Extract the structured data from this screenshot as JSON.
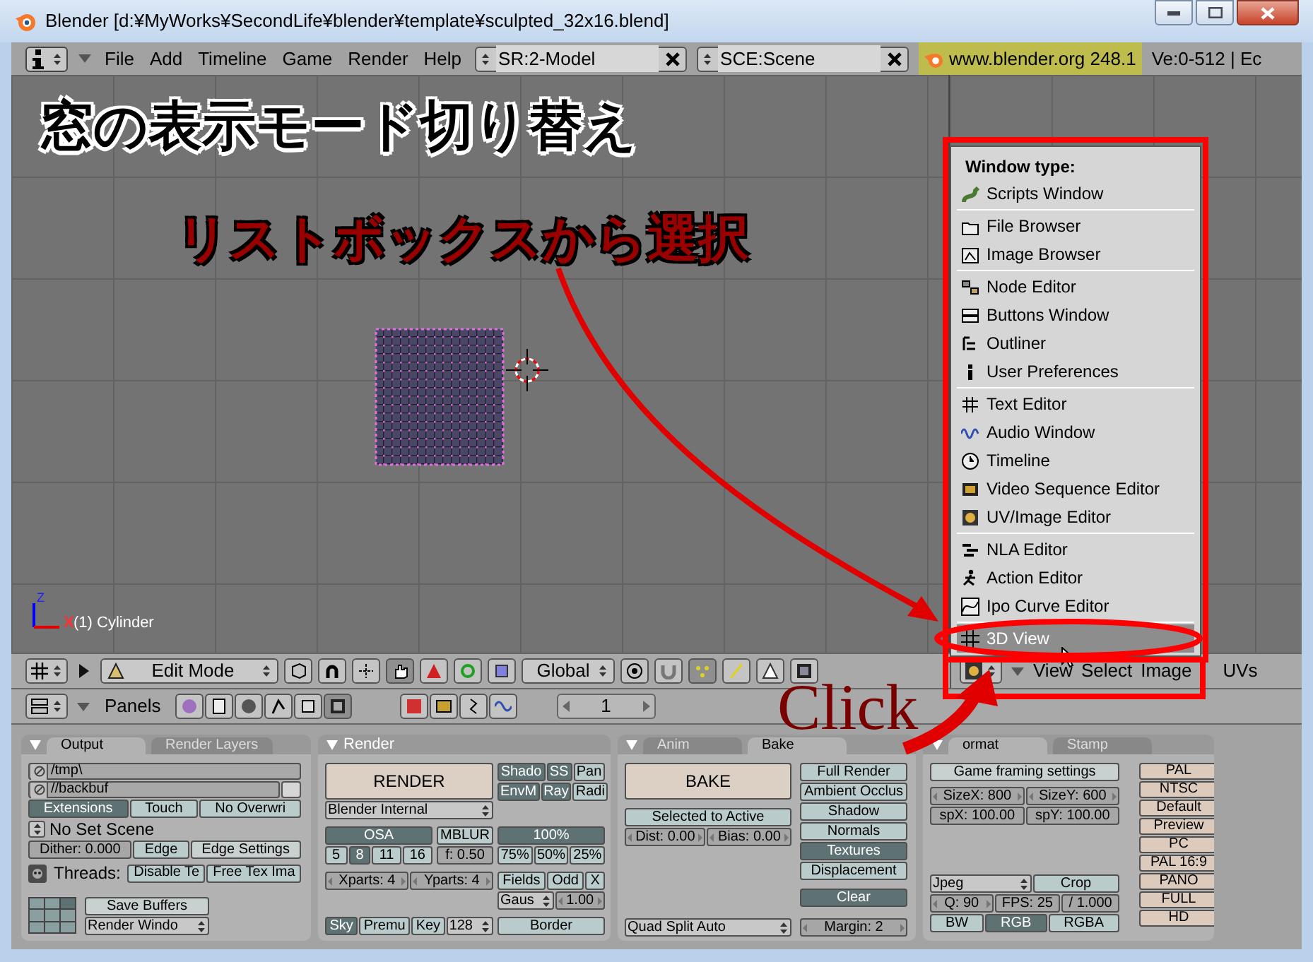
{
  "window": {
    "title": "Blender [d:¥MyWorks¥SecondLife¥blender¥template¥sculpted_32x16.blend]"
  },
  "menubar": {
    "menus": [
      "File",
      "Add",
      "Timeline",
      "Game",
      "Render",
      "Help"
    ],
    "screen": "SR:2-Model",
    "scene": "SCE:Scene",
    "version": "www.blender.org 248.1",
    "stats": "Ve:0-512 | Ec"
  },
  "viewport": {
    "object_label": "(1) Cylinder",
    "axes": [
      "Z",
      "X"
    ]
  },
  "annotations": {
    "heading": "窓の表示モード切り替え",
    "subheading": "リストボックスから選択",
    "callout": "Click"
  },
  "window_type_menu": {
    "title": "Window type:",
    "groups": [
      [
        {
          "label": "Scripts Window",
          "highlighted": false
        }
      ],
      [
        {
          "label": "File Browser",
          "highlighted": false
        },
        {
          "label": "Image Browser",
          "highlighted": false
        }
      ],
      [
        {
          "label": "Node Editor",
          "highlighted": false
        },
        {
          "label": "Buttons Window",
          "highlighted": false
        },
        {
          "label": "Outliner",
          "highlighted": false
        },
        {
          "label": "User Preferences",
          "highlighted": false
        }
      ],
      [
        {
          "label": "Text Editor",
          "highlighted": false
        },
        {
          "label": "Audio Window",
          "highlighted": false
        },
        {
          "label": "Timeline",
          "highlighted": false
        },
        {
          "label": "Video Sequence Editor",
          "highlighted": false
        },
        {
          "label": "UV/Image Editor",
          "highlighted": false
        }
      ],
      [
        {
          "label": "NLA Editor",
          "highlighted": false
        },
        {
          "label": "Action Editor",
          "highlighted": false
        },
        {
          "label": "Ipo Curve Editor",
          "highlighted": false
        }
      ],
      [
        {
          "label": "3D View",
          "highlighted": true
        }
      ]
    ]
  },
  "view_header": {
    "mode": "Edit Mode",
    "orientation": "Global"
  },
  "image_header": {
    "menus": [
      "View",
      "Select",
      "Image",
      "UVs"
    ]
  },
  "buttons_header": {
    "label": "Panels",
    "frame": "1"
  },
  "panels": [
    {
      "tabs": [
        {
          "label": "Output",
          "selected": true
        },
        {
          "label": "Render Layers",
          "selected": false
        }
      ],
      "sections": [
        {
          "kind": "buttons",
          "lines": [
            [
              {
                "kind": "path",
                "label": "/tmp\\"
              }
            ],
            [
              {
                "kind": "path",
                "label": "//backbuf"
              },
              {
                "kind": "square"
              }
            ],
            [
              {
                "kind": "toggle",
                "label": "Extensions",
                "on": true
              },
              {
                "kind": "toggle",
                "label": "Touch",
                "on": false
              },
              {
                "kind": "toggle",
                "label": "No Overwri",
                "on": false
              }
            ],
            [
              {
                "kind": "picker",
                "label": "No Set Scene"
              }
            ],
            [
              {
                "kind": "value",
                "label": "Dither: 0.000"
              },
              {
                "kind": "toggle",
                "label": "Edge",
                "on": false
              },
              {
                "kind": "push",
                "label": "Edge Settings"
              }
            ],
            [
              {
                "kind": "iconbutton"
              },
              {
                "kind": "label",
                "label": "Threads:"
              },
              {
                "kind": "toggle",
                "label": "Disable Te",
                "on": false
              },
              {
                "kind": "toggle",
                "label": "Free Tex Ima",
                "on": false
              }
            ]
          ]
        },
        {
          "kind": "layout"
        },
        {
          "kind": "buttons",
          "lines": [
            [
              {
                "kind": "push",
                "label": "Save Buffers"
              }
            ],
            [
              {
                "kind": "menu",
                "label": "Render Windo"
              }
            ]
          ]
        }
      ]
    },
    {
      "title": "Render",
      "sections": [
        {
          "kind": "buttons",
          "lines": [
            [
              {
                "kind": "bigaction",
                "label": "RENDER"
              }
            ],
            [
              {
                "kind": "menu",
                "label": "Blender Internal"
              }
            ]
          ]
        },
        {
          "kind": "buttons",
          "lines": [
            [
              {
                "kind": "toggle",
                "label": "Shado",
                "on": true
              },
              {
                "kind": "toggle",
                "label": "SS",
                "on": true
              },
              {
                "kind": "toggle",
                "label": "Pan",
                "on": false
              }
            ],
            [
              {
                "kind": "toggle",
                "label": "EnvM",
                "on": true
              },
              {
                "kind": "toggle",
                "label": "Ray",
                "on": true
              },
              {
                "kind": "toggle",
                "label": "Radi",
                "on": false
              }
            ]
          ]
        },
        {
          "kind": "buttons",
          "lines": [
            [
              {
                "kind": "toggle",
                "label": "OSA",
                "on": true
              }
            ],
            [
              {
                "kind": "toggle",
                "label": "5",
                "on": false
              },
              {
                "kind": "toggle",
                "label": "8",
                "on": true
              },
              {
                "kind": "toggle",
                "label": "11",
                "on": false
              },
              {
                "kind": "toggle",
                "label": "16",
                "on": false
              }
            ]
          ]
        },
        {
          "kind": "buttons",
          "lines": [
            [
              {
                "kind": "toggle",
                "label": "MBLUR",
                "on": false
              }
            ],
            [
              {
                "kind": "value",
                "label": "f: 0.50"
              }
            ]
          ]
        },
        {
          "kind": "buttons",
          "lines": [
            [
              {
                "kind": "toggle",
                "label": "100%",
                "on": true
              }
            ],
            [
              {
                "kind": "toggle",
                "label": "75%",
                "on": false
              },
              {
                "kind": "toggle",
                "label": "50%",
                "on": false
              },
              {
                "kind": "toggle",
                "label": "25%",
                "on": false
              }
            ]
          ]
        },
        {
          "kind": "buttons",
          "lines": [
            [
              {
                "kind": "number",
                "label": "Xparts: 4"
              },
              {
                "kind": "number",
                "label": "Yparts: 4"
              }
            ]
          ]
        },
        {
          "kind": "buttons",
          "lines": [
            [
              {
                "kind": "toggle",
                "label": "Fields",
                "on": false
              },
              {
                "kind": "toggle",
                "label": "Odd",
                "on": false
              },
              {
                "kind": "toggle",
                "label": "X",
                "on": false
              }
            ],
            [
              {
                "kind": "menu",
                "label": "Gaus"
              },
              {
                "kind": "number",
                "label": "1.00"
              }
            ]
          ]
        },
        {
          "kind": "buttons",
          "lines": [
            [
              {
                "kind": "toggle",
                "label": "Sky",
                "on": true
              },
              {
                "kind": "toggle",
                "label": "Premu",
                "on": false
              },
              {
                "kind": "toggle",
                "label": "Key",
                "on": false
              },
              {
                "kind": "menu",
                "label": "128"
              }
            ]
          ]
        },
        {
          "kind": "buttons",
          "lines": [
            [
              {
                "kind": "toggle",
                "label": "Border",
                "on": false
              }
            ]
          ]
        }
      ]
    },
    {
      "tabs": [
        {
          "label": "Anim",
          "selected": false
        },
        {
          "label": "Bake",
          "selected": true
        }
      ],
      "sections": [
        {
          "kind": "buttons",
          "lines": [
            [
              {
                "kind": "bigaction",
                "label": "BAKE"
              }
            ]
          ]
        },
        {
          "kind": "buttons",
          "lines": [
            [
              {
                "kind": "toggle",
                "label": "Selected to Active",
                "on": false
              }
            ],
            [
              {
                "kind": "number",
                "label": "Dist: 0.00"
              },
              {
                "kind": "number",
                "label": "Bias: 0.00"
              }
            ]
          ]
        },
        {
          "kind": "buttons",
          "lines": [
            [
              {
                "kind": "toggle",
                "label": "Full Render",
                "on": false
              }
            ],
            [
              {
                "kind": "toggle",
                "label": "Ambient Occlus",
                "on": false
              }
            ],
            [
              {
                "kind": "toggle",
                "label": "Shadow",
                "on": false
              }
            ],
            [
              {
                "kind": "toggle",
                "label": "Normals",
                "on": false
              }
            ],
            [
              {
                "kind": "toggle",
                "label": "Textures",
                "on": true
              }
            ],
            [
              {
                "kind": "toggle",
                "label": "Displacement",
                "on": false
              }
            ]
          ]
        },
        {
          "kind": "buttons",
          "lines": [
            [
              {
                "kind": "menu",
                "label": "Quad Split Auto"
              }
            ]
          ]
        },
        {
          "kind": "buttons",
          "lines": [
            [
              {
                "kind": "command",
                "label": "Clear"
              }
            ],
            [
              {
                "kind": "number",
                "label": "Margin: 2"
              }
            ]
          ]
        }
      ]
    },
    {
      "tabs": [
        {
          "label": "ormat",
          "selected": true
        },
        {
          "label": "Stamp",
          "selected": false
        }
      ],
      "sections": [
        {
          "kind": "buttons",
          "lines": [
            [
              {
                "kind": "push",
                "label": "Game framing settings"
              }
            ]
          ]
        },
        {
          "kind": "buttons",
          "lines": [
            [
              {
                "kind": "number",
                "label": "SizeX: 800"
              },
              {
                "kind": "number",
                "label": "SizeY: 600"
              }
            ],
            [
              {
                "kind": "value",
                "label": "spX: 100.00"
              },
              {
                "kind": "value",
                "label": "spY: 100.00"
              }
            ]
          ]
        },
        {
          "kind": "buttons",
          "lines": [
            [
              {
                "kind": "menu",
                "label": "Jpeg"
              },
              {
                "kind": "toggle",
                "label": "Crop",
                "on": false
              }
            ],
            [
              {
                "kind": "number",
                "label": "Q: 90"
              },
              {
                "kind": "value",
                "label": "FPS: 25"
              },
              {
                "kind": "value",
                "label": "/ 1.000"
              }
            ],
            [
              {
                "kind": "toggle",
                "label": "BW",
                "on": false
              },
              {
                "kind": "toggle",
                "label": "RGB",
                "on": true
              },
              {
                "kind": "toggle",
                "label": "RGBA",
                "on": false
              }
            ]
          ]
        },
        {
          "kind": "buttons",
          "lines": [
            [
              {
                "kind": "action",
                "label": "PAL"
              }
            ],
            [
              {
                "kind": "action",
                "label": "NTSC"
              }
            ],
            [
              {
                "kind": "action",
                "label": "Default"
              }
            ],
            [
              {
                "kind": "action",
                "label": "Preview"
              }
            ],
            [
              {
                "kind": "action",
                "label": "PC"
              }
            ],
            [
              {
                "kind": "action",
                "label": "PAL 16:9"
              }
            ],
            [
              {
                "kind": "action",
                "label": "PANO"
              }
            ],
            [
              {
                "kind": "action",
                "label": "FULL"
              }
            ],
            [
              {
                "kind": "action",
                "label": "HD"
              }
            ]
          ]
        }
      ]
    }
  ]
}
